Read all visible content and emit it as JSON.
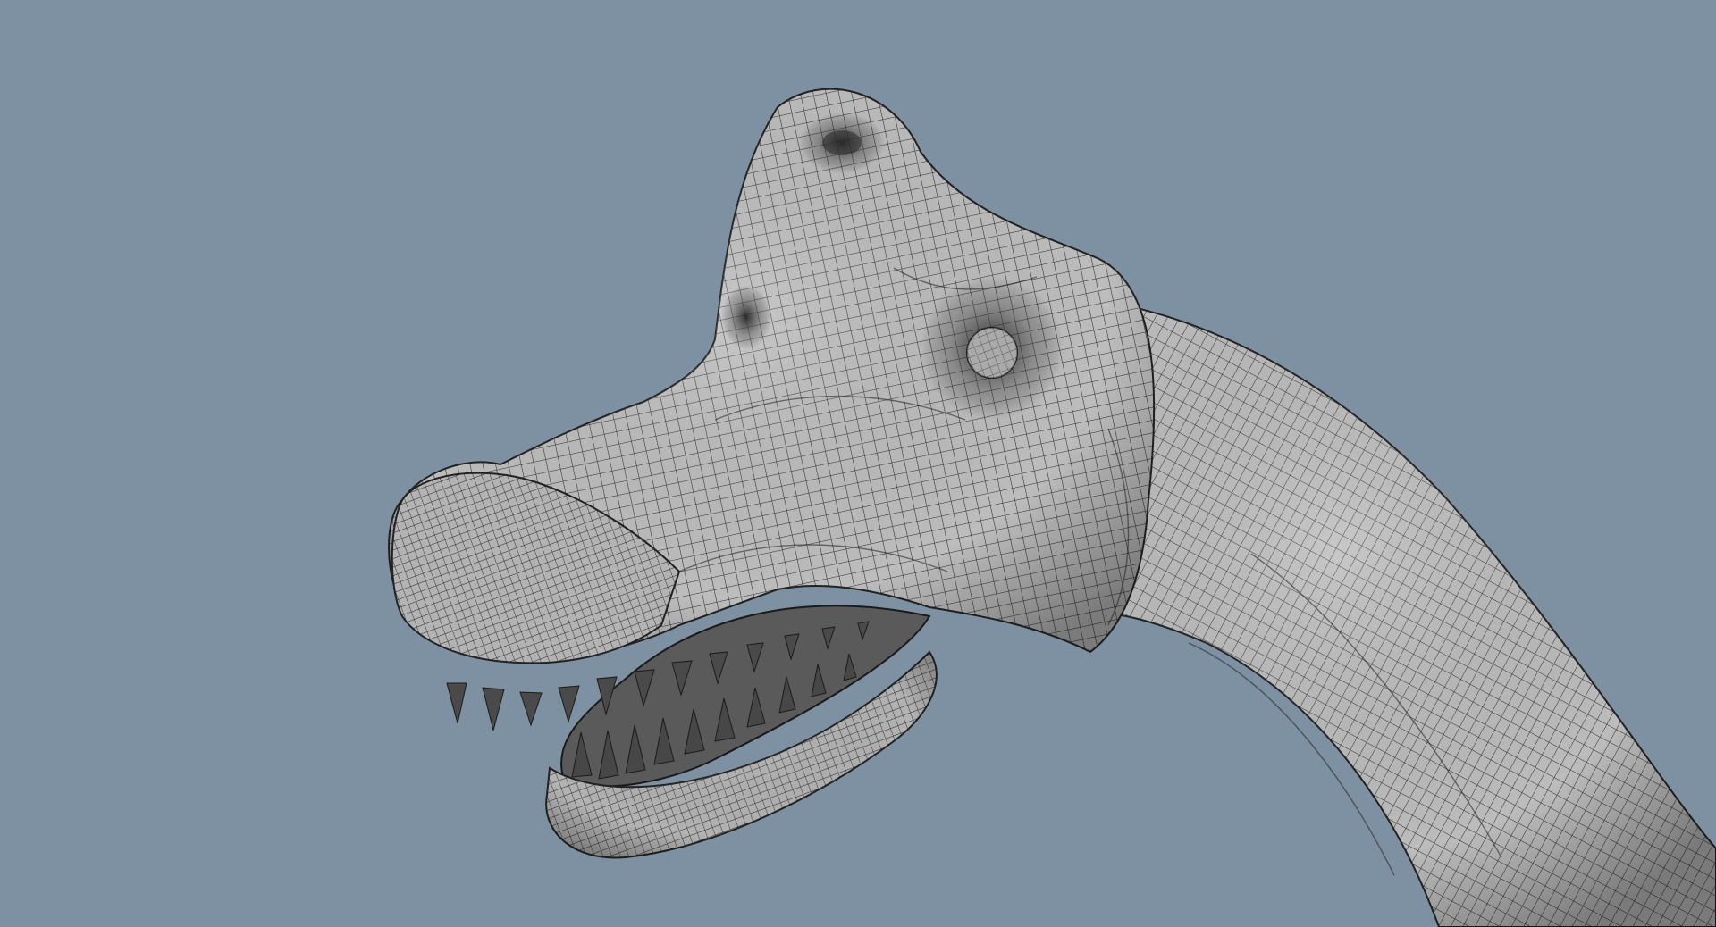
{
  "viewport": {
    "background_color": "#7e91a2",
    "mesh_fill_color": "#b9b9b9",
    "mesh_wire_color": "#2a2a2a",
    "mouth_interior_color": "#5a5a5a",
    "teeth_color": "#4a4a4a",
    "subject": "dinosaur-head-wireframe-model"
  }
}
